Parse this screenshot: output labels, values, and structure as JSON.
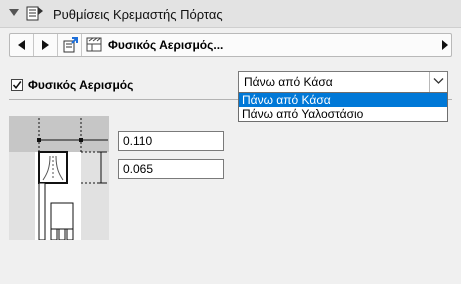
{
  "header": {
    "title": "Ρυθμίσεις Κρεμαστής Πόρτας"
  },
  "toolbar": {
    "title": "Φυσικός Αερισμός..."
  },
  "ventilation": {
    "checkbox_label": "Φυσικός Αερισμός",
    "checked": true,
    "selected": "Πάνω από Κάσα",
    "options": [
      "Πάνω από Κάσα",
      "Πάνω από Υαλοστάσιο"
    ]
  },
  "dimensions": {
    "value_1": "0.110",
    "value_2": "0.065"
  },
  "colors": {
    "selection": "#0078d7",
    "panel": "#f0f0f0"
  }
}
